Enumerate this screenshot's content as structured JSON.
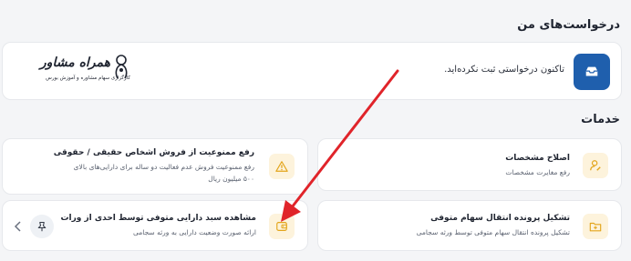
{
  "requests": {
    "title": "درخواست‌های من",
    "empty_text": "تاکنون درخواستی ثبت نکرده‌اید."
  },
  "watermark": {
    "name": "همراه مشاور",
    "tagline": "کارگزاری سهام مشاوره و آموزش بورس"
  },
  "services": {
    "title": "خدمات",
    "cards": [
      {
        "title": "اصلاح مشخصات",
        "desc": "رفع مغایرت مشخصات",
        "icon": "user-edit-icon"
      },
      {
        "title": "رفع ممنوعیت از فروش اشخاص حقیقی / حقوقی",
        "desc": "رفع ممنوعیت فروش عدم فعالیت دو ساله برای دارایی‌های بالای ۵۰۰ میلیون ریال",
        "icon": "warning-icon"
      },
      {
        "title": "تشکیل پرونده انتقال سهام متوفی",
        "desc": "تشکیل پرونده انتقال سهام متوفی توسط ورثه سجامی",
        "icon": "folder-plus-icon"
      },
      {
        "title": "مشاهده سبد دارایی متوفی توسط احدی از ورات",
        "desc": "ارائه صورت وضعیت دارایی به ورثه سجامی",
        "icon": "wallet-icon"
      }
    ]
  },
  "colors": {
    "accent": "#1f5fad",
    "icon_bg": "#fdf3dc",
    "icon_fg": "#e3a51b",
    "arrow": "#e0242a"
  }
}
